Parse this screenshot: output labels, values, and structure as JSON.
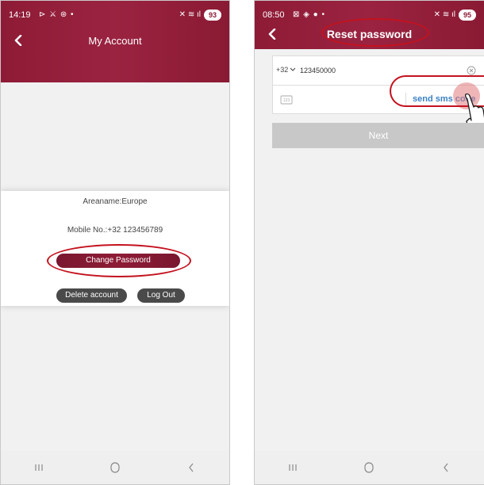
{
  "left_screen": {
    "status": {
      "time": "14:19",
      "extra": "⊳ ⚔ ⊛ •",
      "signal": "✕ ≋ ıl",
      "battery": "93"
    },
    "header": {
      "title": "My Account"
    },
    "account": {
      "area": "Areaname:Europe",
      "mobile": "Mobile No.:+32 123456789"
    },
    "buttons": {
      "change_password": "Change Password",
      "delete_account": "Delete account",
      "logout": "Log Out"
    }
  },
  "right_screen": {
    "status": {
      "time": "08:50",
      "extra": "⊠ ◈ ● •",
      "signal": "✕ ≋ ıl",
      "battery": "95"
    },
    "header": {
      "title": "Reset password"
    },
    "form": {
      "country_code": "+32",
      "phone_value": "123450000",
      "code_placeholder": "",
      "send_sms_label": "send sms code"
    },
    "next_label": "Next"
  },
  "colors": {
    "brand": "#8e1b36",
    "dark_button": "#4a4a4a",
    "link": "#3b82c4",
    "annotation": "#c4121e",
    "disabled": "#c8c8c8"
  },
  "icons": [
    "back-arrow-icon",
    "clear-icon",
    "sms-code-icon",
    "pointing-hand-icon",
    "recent-apps-icon",
    "home-icon",
    "back-icon"
  ]
}
